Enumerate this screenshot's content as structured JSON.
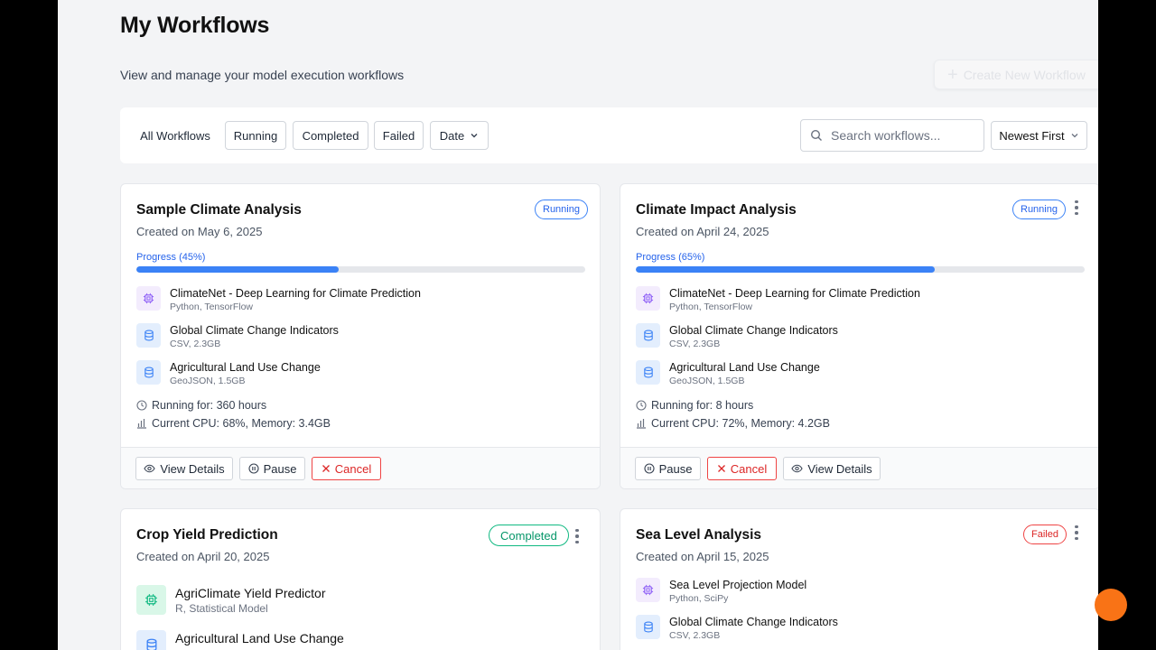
{
  "page": {
    "title": "My Workflows",
    "subtitle": "View and manage your model execution workflows",
    "create_button": "Create New Workflow"
  },
  "filters": {
    "all": "All Workflows",
    "running": "Running",
    "completed": "Completed",
    "failed": "Failed",
    "date": "Date",
    "search_placeholder": "Search workflows...",
    "sort": "Newest First"
  },
  "cards": [
    {
      "title": "Sample Climate Analysis",
      "created": "Created on May 6, 2025",
      "status": "Running",
      "progress_label": "Progress (45%)",
      "progress": 45,
      "resources": [
        {
          "name": "ClimateNet - Deep Learning for Climate Prediction",
          "meta": "Python, TensorFlow",
          "icon": "chip-icon"
        },
        {
          "name": "Global Climate Change Indicators",
          "meta": "CSV, 2.3GB",
          "icon": "database-icon"
        },
        {
          "name": "Agricultural Land Use Change",
          "meta": "GeoJSON, 1.5GB",
          "icon": "database-icon"
        }
      ],
      "running_for": "Running for: 360 hours",
      "usage": "Current CPU: 68%, Memory: 3.4GB",
      "actions": [
        "View Details",
        "Pause",
        "Cancel"
      ]
    },
    {
      "title": "Climate Impact Analysis",
      "created": "Created on April 24, 2025",
      "status": "Running",
      "progress_label": "Progress (65%)",
      "progress": 65,
      "resources": [
        {
          "name": "ClimateNet - Deep Learning for Climate Prediction",
          "meta": "Python, TensorFlow",
          "icon": "chip-icon"
        },
        {
          "name": "Global Climate Change Indicators",
          "meta": "CSV, 2.3GB",
          "icon": "database-icon"
        },
        {
          "name": "Agricultural Land Use Change",
          "meta": "GeoJSON, 1.5GB",
          "icon": "database-icon"
        }
      ],
      "running_for": "Running for: 8 hours",
      "usage": "Current CPU: 72%, Memory: 4.2GB",
      "actions": [
        "Pause",
        "Cancel",
        "View Details"
      ]
    },
    {
      "title": "Crop Yield Prediction",
      "created": "Created on April 20, 2025",
      "status": "Completed",
      "resources": [
        {
          "name": "AgriClimate Yield Predictor",
          "meta": "R, Statistical Model",
          "icon": "chip-icon"
        },
        {
          "name": "Agricultural Land Use Change",
          "meta": "",
          "icon": "database-icon"
        }
      ]
    },
    {
      "title": "Sea Level Analysis",
      "created": "Created on April 15, 2025",
      "status": "Failed",
      "resources": [
        {
          "name": "Sea Level Projection Model",
          "meta": "Python, SciPy",
          "icon": "chip-icon"
        },
        {
          "name": "Global Climate Change Indicators",
          "meta": "CSV, 2.3GB",
          "icon": "database-icon"
        }
      ]
    }
  ],
  "colors": {
    "accent": "#3b82f6",
    "running": "#2563eb",
    "completed": "#059669",
    "failed": "#dc2626",
    "model_icon": "#8b5cf6",
    "data_icon": "#3b82f6"
  }
}
